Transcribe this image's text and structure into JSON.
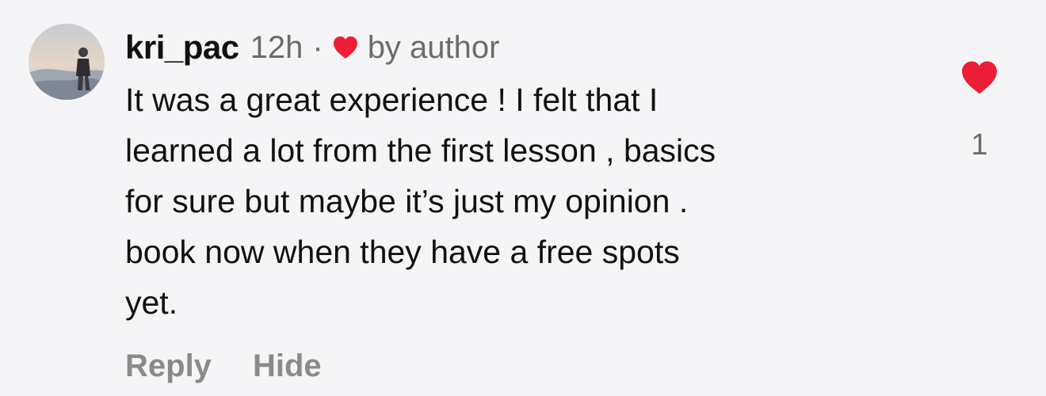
{
  "comment": {
    "username": "kri_pac",
    "time": "12h",
    "separator": "·",
    "liked_by_author_label": "by author",
    "text": "It was a great experience ! I felt that I\nlearned a lot from the first lesson , basics\nfor sure but maybe it’s just my opinion .\nbook now when they have a free spots\nyet.",
    "like_count": "1",
    "actions": {
      "reply_label": "Reply",
      "hide_label": "Hide"
    }
  },
  "icons": {
    "avatar": "profile-photo",
    "author_heart": "heart-icon",
    "like": "heart-filled-icon"
  },
  "colors": {
    "background": "#f5f5f7",
    "heart": "#ee1d36",
    "muted_text": "#6b6b6b",
    "action_text": "#8a8a8a"
  }
}
